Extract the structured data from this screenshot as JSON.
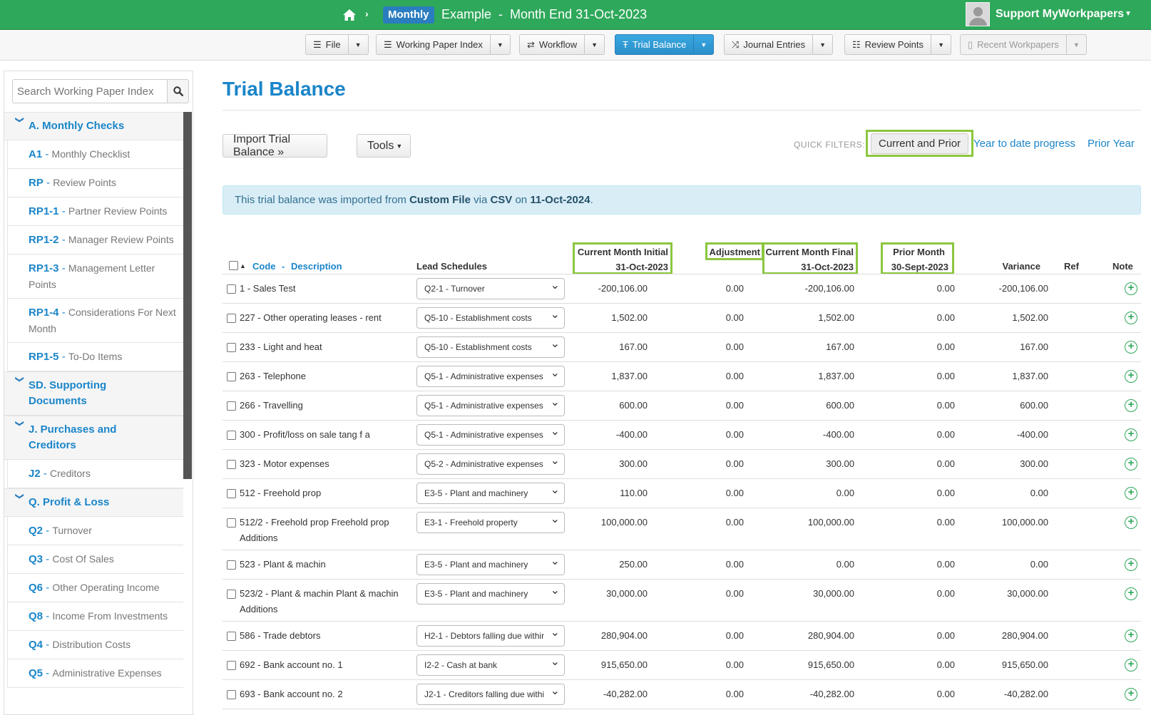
{
  "topbar": {
    "period_badge": "Monthly",
    "title": "Example  -  Month End 31-Oct-2023",
    "user": "Support MyWorkpapers",
    "brand_color": "#2ea85a"
  },
  "toolbar": {
    "file": "File",
    "working_paper_index": "Working Paper Index",
    "workflow": "Workflow",
    "trial_balance": "Trial Balance",
    "journal_entries": "Journal Entries",
    "review_points": "Review Points",
    "recent_workpapers": "Recent Workpapers"
  },
  "sidebar": {
    "search_placeholder": "Search Working Paper Index",
    "sections": [
      {
        "label": "A. Monthly Checks",
        "items": [
          {
            "code": "A1",
            "name": "Monthly Checklist"
          },
          {
            "code": "RP",
            "name": "Review Points"
          },
          {
            "code": "RP1-1",
            "name": "Partner Review Points"
          },
          {
            "code": "RP1-2",
            "name": "Manager Review Points"
          },
          {
            "code": "RP1-3",
            "name": "Management Letter Points"
          },
          {
            "code": "RP1-4",
            "name": "Considerations For Next Month"
          },
          {
            "code": "RP1-5",
            "name": "To-Do Items"
          }
        ]
      },
      {
        "label": "SD. Supporting Documents",
        "items": []
      },
      {
        "label": "J. Purchases and Creditors",
        "items": [
          {
            "code": "J2",
            "name": "Creditors"
          }
        ]
      },
      {
        "label": "Q. Profit & Loss",
        "items": [
          {
            "code": "Q2",
            "name": "Turnover"
          },
          {
            "code": "Q3",
            "name": "Cost Of Sales"
          },
          {
            "code": "Q6",
            "name": "Other Operating Income"
          },
          {
            "code": "Q8",
            "name": "Income From Investments"
          },
          {
            "code": "Q4",
            "name": "Distribution Costs"
          },
          {
            "code": "Q5",
            "name": "Administrative Expenses"
          }
        ]
      }
    ]
  },
  "main": {
    "title": "Trial Balance",
    "import_button": "Import Trial Balance »",
    "tools_button": "Tools",
    "quick_filters_label": "QUICK FILTERS:",
    "quick_filters": [
      "Current and Prior",
      "Year to date progress",
      "Prior Year"
    ],
    "alert": {
      "prefix": "This trial balance was imported from ",
      "source": "Custom File",
      "via": " via ",
      "format": "CSV",
      "on": " on ",
      "date": "11-Oct-2024",
      "suffix": "."
    }
  },
  "table": {
    "headers": {
      "code": "Code",
      "dash": "-",
      "description": "Description",
      "lead_schedules": "Lead Schedules",
      "cm_initial_1": "Current Month Initial",
      "cm_initial_2": "31-Oct-2023",
      "adjustment": "Adjustment",
      "cm_final_1": "Current Month Final",
      "cm_final_2": "31-Oct-2023",
      "prior_1": "Prior Month",
      "prior_2": "30-Sept-2023",
      "variance": "Variance",
      "ref": "Ref",
      "note": "Note"
    },
    "rows": [
      {
        "desc": "1 - Sales Test",
        "lead": "Q2-1 - Turnover",
        "initial": "-200,106.00",
        "adjustment": "0.00",
        "final": "-200,106.00",
        "prior": "0.00",
        "variance": "-200,106.00"
      },
      {
        "desc": "227 - Other operating leases - rent",
        "lead": "Q5-10 - Establishment costs",
        "initial": "1,502.00",
        "adjustment": "0.00",
        "final": "1,502.00",
        "prior": "0.00",
        "variance": "1,502.00"
      },
      {
        "desc": "233 - Light and heat",
        "lead": "Q5-10 - Establishment costs",
        "initial": "167.00",
        "adjustment": "0.00",
        "final": "167.00",
        "prior": "0.00",
        "variance": "167.00"
      },
      {
        "desc": "263 - Telephone",
        "lead": "Q5-1 - Administrative expenses",
        "initial": "1,837.00",
        "adjustment": "0.00",
        "final": "1,837.00",
        "prior": "0.00",
        "variance": "1,837.00"
      },
      {
        "desc": "266 - Travelling",
        "lead": "Q5-1 - Administrative expenses",
        "initial": "600.00",
        "adjustment": "0.00",
        "final": "600.00",
        "prior": "0.00",
        "variance": "600.00"
      },
      {
        "desc": "300 - Profit/loss on sale tang f a",
        "lead": "Q5-1 - Administrative expenses",
        "initial": "-400.00",
        "adjustment": "0.00",
        "final": "-400.00",
        "prior": "0.00",
        "variance": "-400.00"
      },
      {
        "desc": "323 - Motor expenses",
        "lead": "Q5-2 - Administrative expenses",
        "initial": "300.00",
        "adjustment": "0.00",
        "final": "300.00",
        "prior": "0.00",
        "variance": "300.00"
      },
      {
        "desc": "512 - Freehold prop",
        "lead": "E3-5 - Plant and machinery",
        "initial": "110.00",
        "adjustment": "0.00",
        "final": "0.00",
        "prior": "0.00",
        "variance": "0.00"
      },
      {
        "desc": "512/2 - Freehold prop Freehold prop Additions",
        "lead": "E3-1 - Freehold property",
        "initial": "100,000.00",
        "adjustment": "0.00",
        "final": "100,000.00",
        "prior": "0.00",
        "variance": "100,000.00"
      },
      {
        "desc": "523 - Plant & machin",
        "lead": "E3-5 - Plant and machinery",
        "initial": "250.00",
        "adjustment": "0.00",
        "final": "0.00",
        "prior": "0.00",
        "variance": "0.00"
      },
      {
        "desc": "523/2 - Plant & machin Plant & machin Additions",
        "lead": "E3-5 - Plant and machinery",
        "initial": "30,000.00",
        "adjustment": "0.00",
        "final": "30,000.00",
        "prior": "0.00",
        "variance": "30,000.00"
      },
      {
        "desc": "586 - Trade debtors",
        "lead": "H2-1 - Debtors falling due withir",
        "initial": "280,904.00",
        "adjustment": "0.00",
        "final": "280,904.00",
        "prior": "0.00",
        "variance": "280,904.00"
      },
      {
        "desc": "692 - Bank account no. 1",
        "lead": "I2-2 - Cash at bank",
        "initial": "915,650.00",
        "adjustment": "0.00",
        "final": "915,650.00",
        "prior": "0.00",
        "variance": "915,650.00"
      },
      {
        "desc": "693 - Bank account no. 2",
        "lead": "J2-1 - Creditors falling due withi",
        "initial": "-40,282.00",
        "adjustment": "0.00",
        "final": "-40,282.00",
        "prior": "0.00",
        "variance": "-40,282.00"
      }
    ]
  }
}
